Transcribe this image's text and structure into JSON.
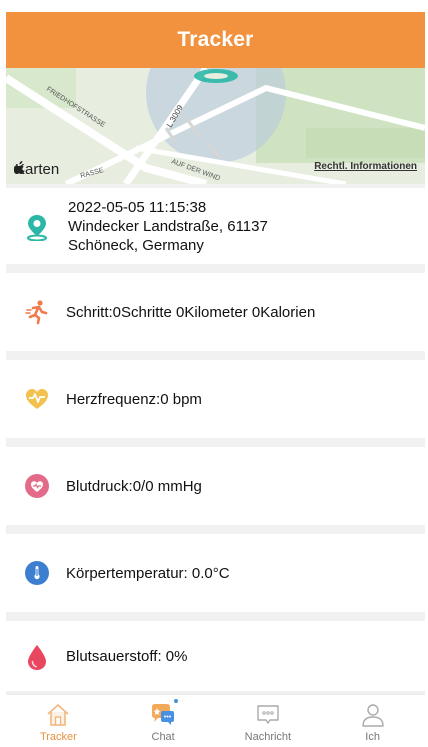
{
  "header": {
    "title": "Tracker"
  },
  "map": {
    "brand": "Karten",
    "legal_link": "Rechtl. Informationen",
    "street_labels": [
      "FRIEDHOFSTRASSE",
      "L 3009",
      "AUF DER WIND",
      "RASSE"
    ]
  },
  "location": {
    "datetime": "2022-05-05 11:15:38",
    "address_line1": "Windecker Landstraße, 61137",
    "address_line2": "Schöneck, Germany"
  },
  "metrics": {
    "steps": "Schritt:0Schritte 0Kilometer 0Kalorien",
    "heart_rate": "Herzfrequenz:0 bpm",
    "blood_pressure": "Blutdruck:0/0 mmHg",
    "temperature": "Körpertemperatur: 0.0°C",
    "oxygen": "Blutsauerstoff: 0%"
  },
  "tabs": [
    {
      "label": "Tracker",
      "icon": "home-icon",
      "active": true
    },
    {
      "label": "Chat",
      "icon": "chat-icon",
      "active": false
    },
    {
      "label": "Nachricht",
      "icon": "message-icon",
      "active": false
    },
    {
      "label": "Ich",
      "icon": "profile-icon",
      "active": false
    }
  ],
  "colors": {
    "accent": "#f2913e",
    "location_icon": "#2bb7a6",
    "steps_icon": "#f07a4a",
    "heart_icon": "#f2c14e",
    "bp_icon": "#e46a8a",
    "temp_icon": "#3c7fd0",
    "oxygen_icon": "#e8475f"
  }
}
